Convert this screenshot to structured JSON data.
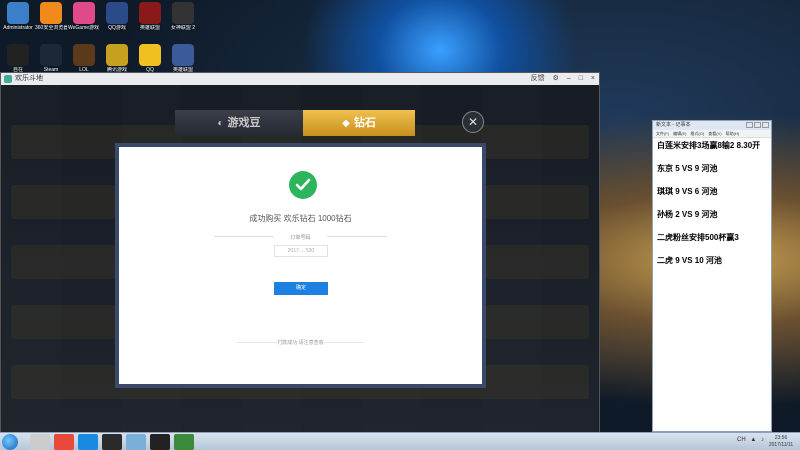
{
  "desktop": {
    "icons": [
      {
        "label": "Administrator",
        "color": "#3a7fc8"
      },
      {
        "label": "360安全浏览器 9",
        "color": "#f08a1a"
      },
      {
        "label": "WeGame游戏 直播",
        "color": "#e04a8a"
      },
      {
        "label": "QQ游戏",
        "color": "#2a4a8a"
      },
      {
        "label": "英雄联盟",
        "color": "#8a1a1a"
      },
      {
        "label": "女神联盟 2",
        "color": "#333333"
      },
      {
        "label": "自在",
        "color": "#222222"
      },
      {
        "label": "Steam",
        "color": "#1b2838"
      },
      {
        "label": "LOL",
        "color": "#5a3a1a"
      },
      {
        "label": "腾讯游戏",
        "color": "#c8a020"
      },
      {
        "label": "QQ",
        "color": "#f0c020"
      },
      {
        "label": "英雄联盟",
        "color": "#3a5a9a"
      }
    ]
  },
  "app": {
    "title": "欢乐斗地",
    "feedback_label": "反馈",
    "tabs": [
      {
        "label": "游戏豆",
        "icon": "bean-icon"
      },
      {
        "label": "钻石",
        "icon": "diamond-icon"
      }
    ],
    "close_symbol": "✕",
    "dialog": {
      "success_message": "成功购买 欢乐钻石 1000钻石",
      "order_label": "订单号码",
      "order_value": "2017  ...  530",
      "confirm_button": "确定",
      "footer_text": "付款成功 请注意查收"
    }
  },
  "notepad": {
    "title": "新文本 - 记事本",
    "menu": [
      "文件(F)",
      "编辑(E)",
      "格式(O)",
      "查看(V)",
      "帮助(H)"
    ],
    "lines": [
      "白莲米安排3场赢8输2 8.30开",
      "东京 5 VS 9 河池",
      "琪琪 9 VS 6 河池",
      "孙杨 2 VS 9 河池",
      "二虎粉丝安排500杯赢3",
      "二虎 9 VS 10 河池"
    ]
  },
  "taskbar": {
    "apps": [
      {
        "name": "user-app",
        "color": "#ccc"
      },
      {
        "name": "chrome",
        "color": "#e84a3a"
      },
      {
        "name": "kugou",
        "color": "#1a8ae0"
      },
      {
        "name": "steam",
        "color": "#2a2a2a"
      },
      {
        "name": "folder",
        "color": "#7ab0d8"
      },
      {
        "name": "game-app",
        "color": "#222"
      },
      {
        "name": "huanle-app",
        "color": "#3a8a3a"
      }
    ],
    "clock_time": "23:56",
    "clock_date": "2017/11/11"
  }
}
